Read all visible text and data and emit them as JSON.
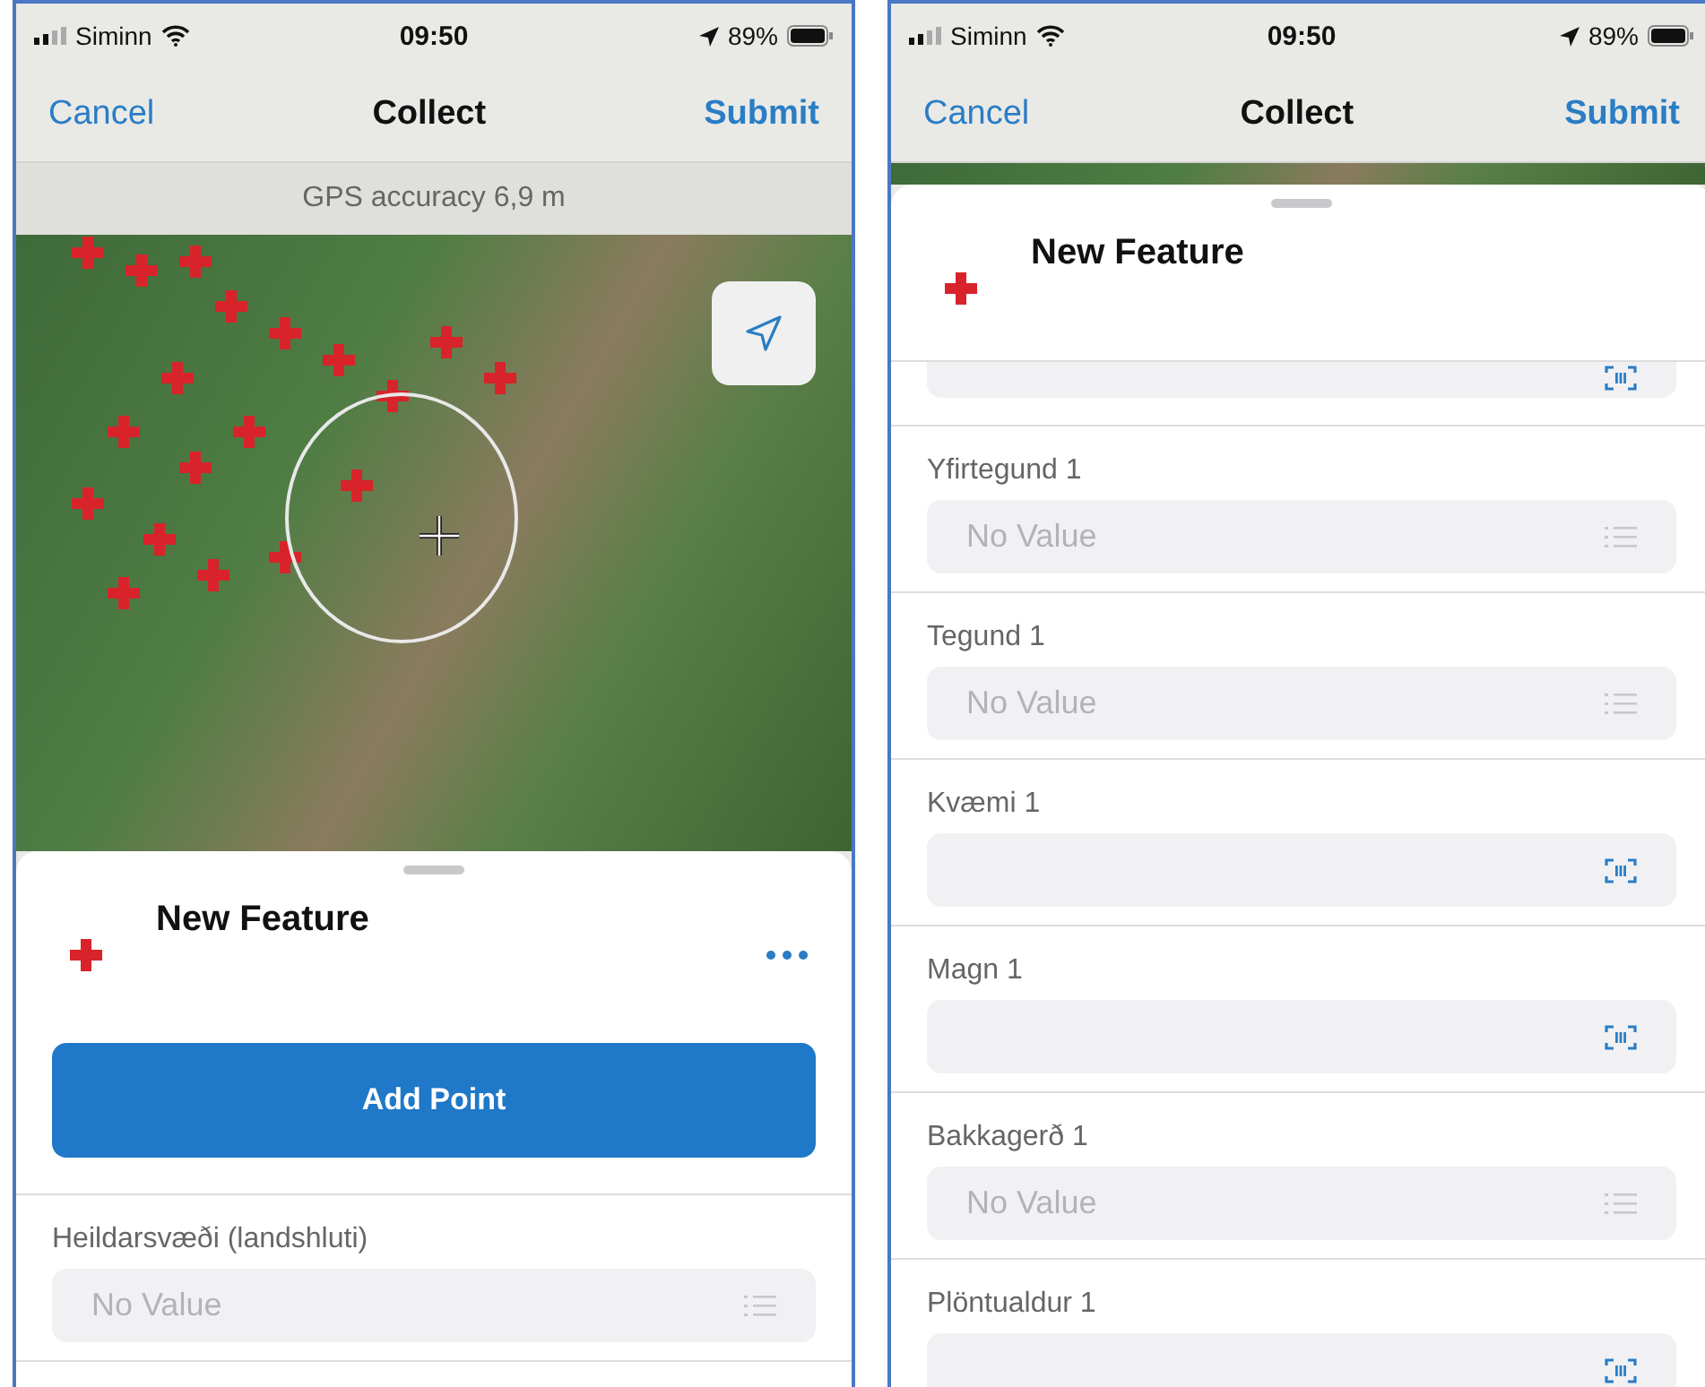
{
  "screens": [
    {
      "status_bar": {
        "carrier": "Siminn",
        "time": "09:50",
        "battery": "89%"
      },
      "nav": {
        "cancel": "Cancel",
        "title": "Collect",
        "submit": "Submit"
      },
      "gps_banner": "GPS accuracy 6,9 m",
      "map": {
        "kind": "full"
      },
      "sheet": {
        "title": "New Feature",
        "more_menu": true,
        "add_point_button": "Add Point",
        "fields": [
          {
            "kind": "choice",
            "label": "Heildarsvæði (landshluti)",
            "placeholder": "No Value"
          }
        ]
      }
    },
    {
      "status_bar": {
        "carrier": "Siminn",
        "time": "09:50",
        "battery": "89%"
      },
      "nav": {
        "cancel": "Cancel",
        "title": "Collect",
        "submit": "Submit"
      },
      "map": {
        "kind": "strip"
      },
      "sheet": {
        "title": "New Feature",
        "more_menu": false,
        "fields": [
          {
            "kind": "barcode"
          },
          {
            "kind": "choice",
            "label": "Yfirtegund 1",
            "placeholder": "No Value"
          },
          {
            "kind": "choice",
            "label": "Tegund 1",
            "placeholder": "No Value"
          },
          {
            "kind": "barcode",
            "label": "Kvæmi 1"
          },
          {
            "kind": "barcode",
            "label": "Magn 1"
          },
          {
            "kind": "choice",
            "label": "Bakkagerð 1",
            "placeholder": "No Value"
          },
          {
            "kind": "barcode",
            "label": "Plöntualdur 1"
          }
        ]
      }
    }
  ]
}
